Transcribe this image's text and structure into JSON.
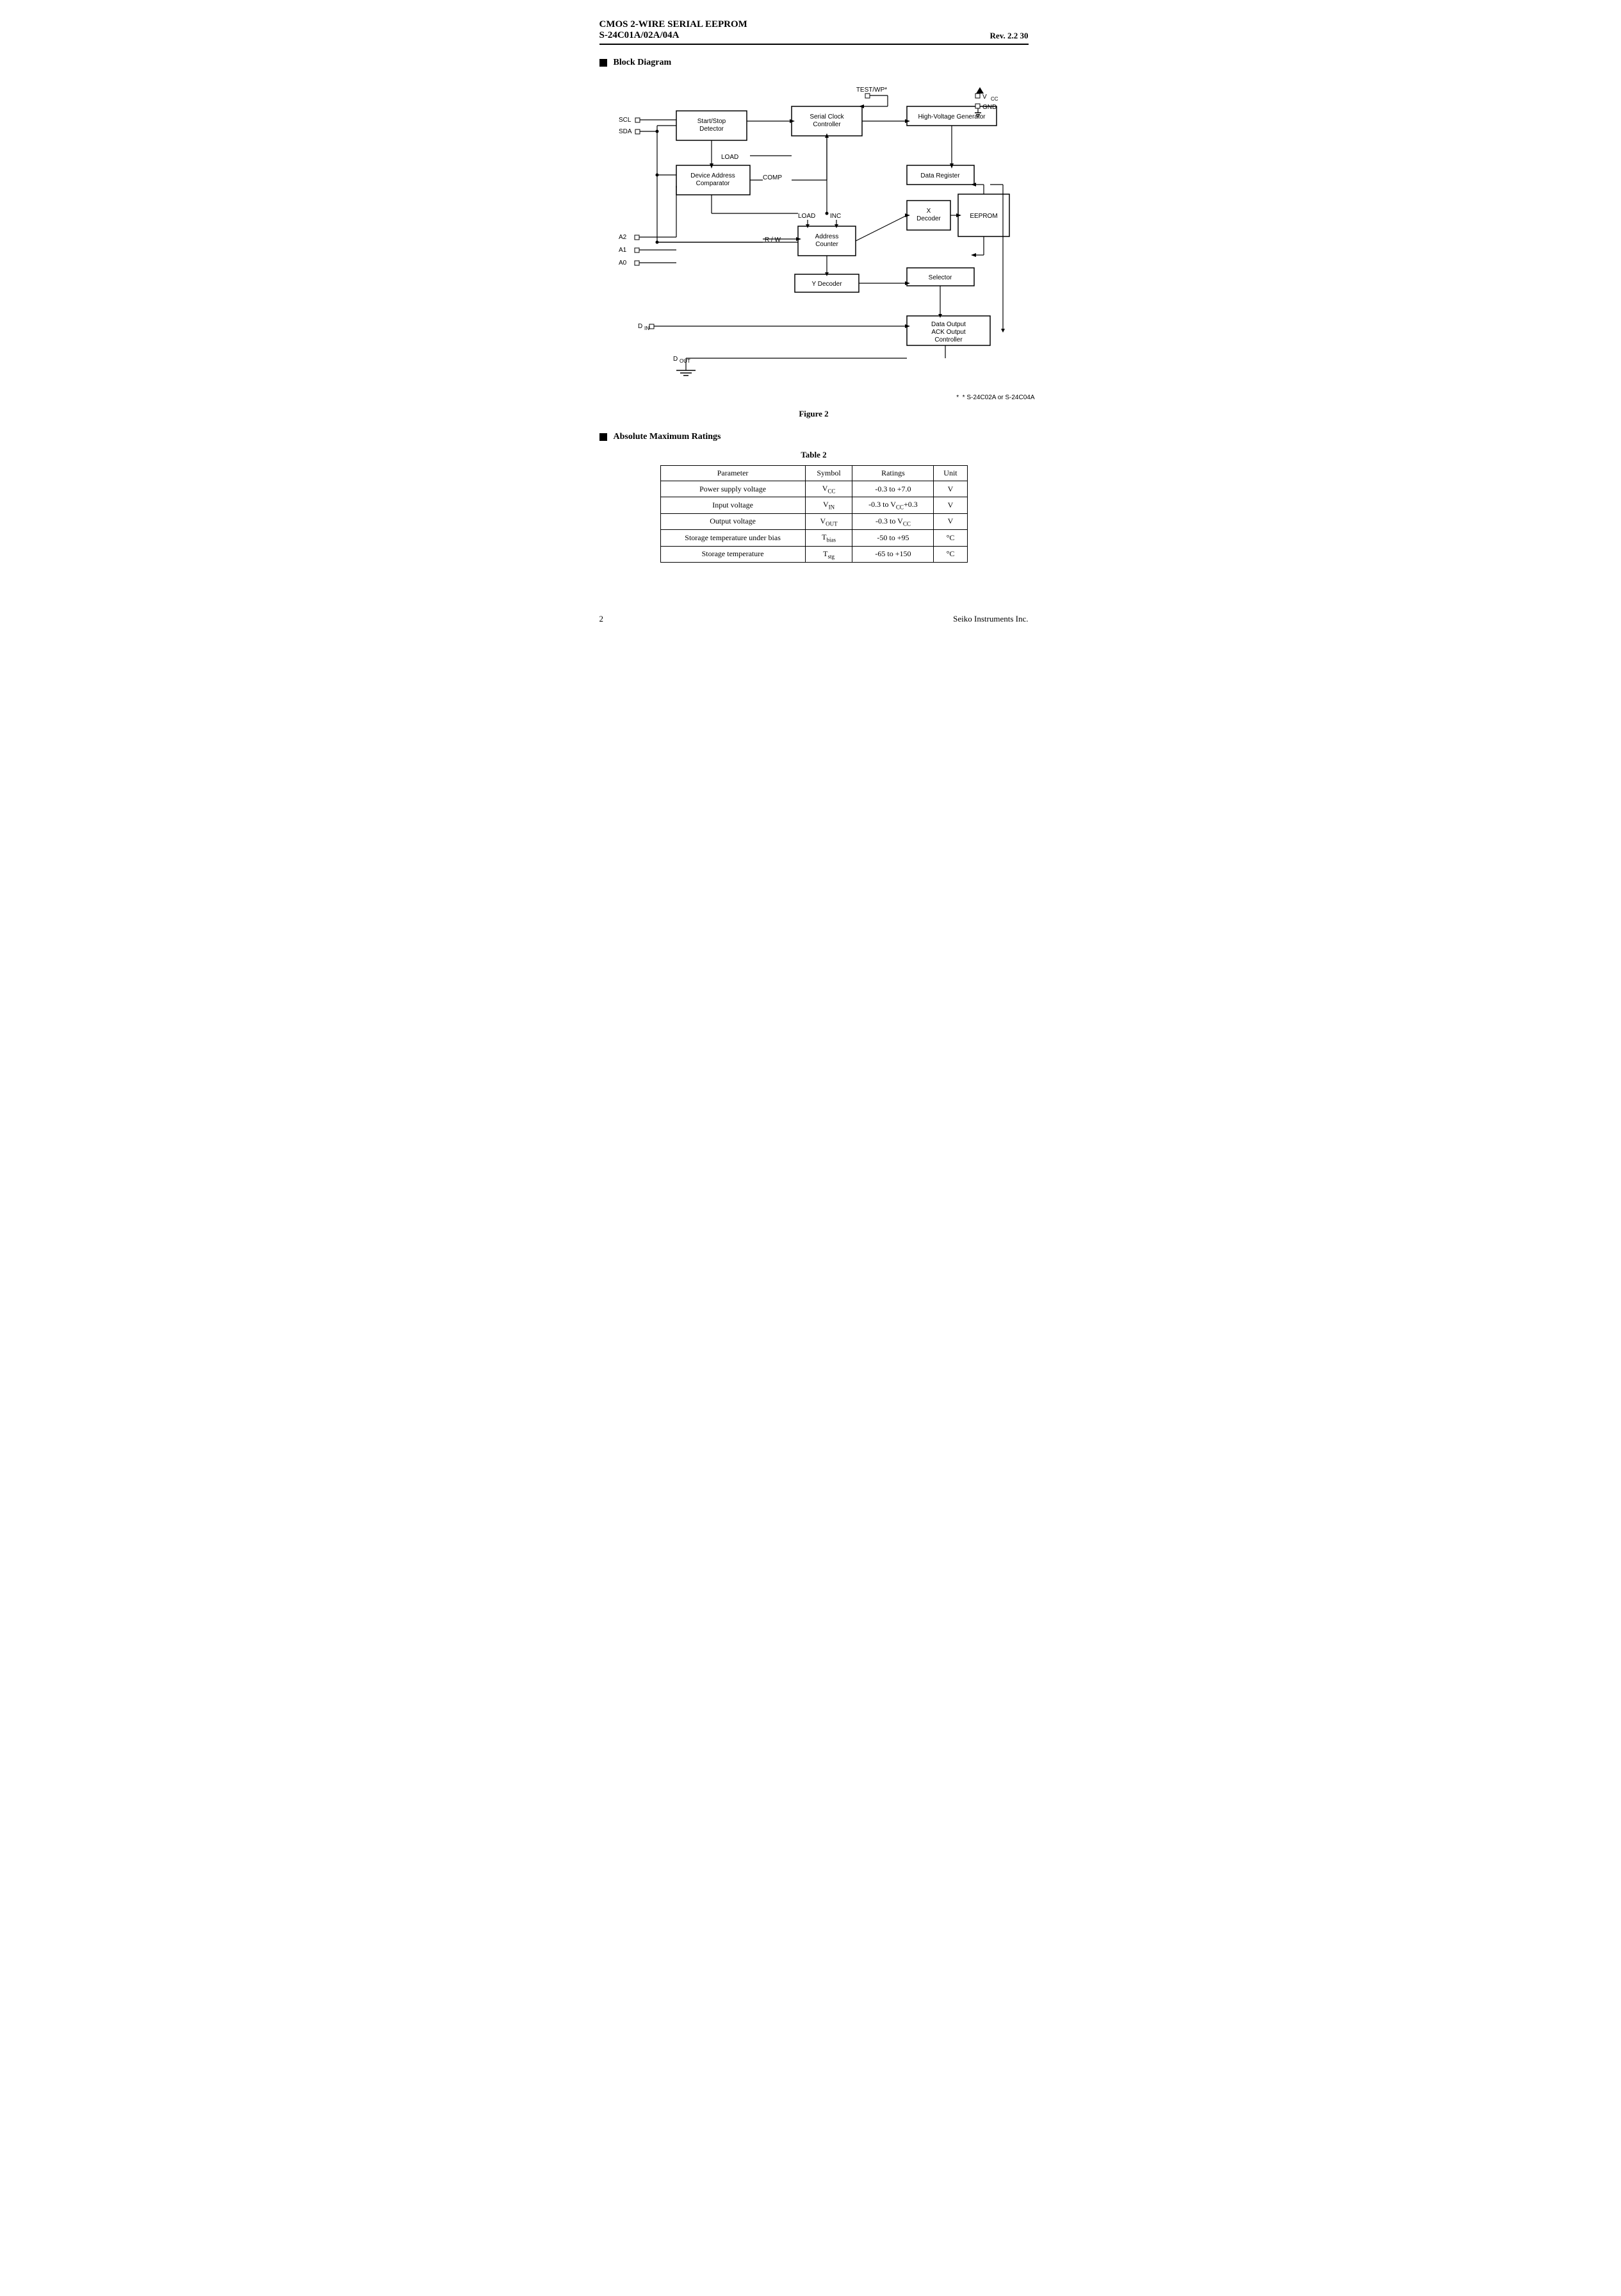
{
  "header": {
    "title": "CMOS 2-WIRE SERIAL  EEPROM",
    "subtitle": "S-24C01A/02A/04A",
    "rev": "Rev. 2.2",
    "page": "30"
  },
  "section1": {
    "label": "Block Diagram"
  },
  "diagram": {
    "blocks": {
      "startStop": "Start/Stop\nDetector",
      "serialClock": "Serial Clock\nController",
      "highVoltage": "High-Voltage Generator",
      "deviceAddr": "Device Address\nComparator",
      "dataRegister": "Data Register",
      "xDecoder": "X\nDecoder",
      "eeprom": "EEPROM",
      "addressCounter": "Address\nCounter",
      "yDecoder": "Y Decoder",
      "selector": "Selector",
      "dataOutput": "Data Output\nACK Output\nController"
    },
    "labels": {
      "scl": "SCL",
      "sda": "SDA",
      "a2": "A2",
      "a1": "A1",
      "a0": "A0",
      "din": "D",
      "din_sub": "IN",
      "dout": "D",
      "dout_sub": "OUT",
      "testWP": "TEST/WP*",
      "vcc": "V",
      "vcc_sub": "CC",
      "gnd": "GND",
      "load1": "LOAD",
      "comp": "COMP",
      "load2": "LOAD",
      "inc": "INC",
      "rw": "R / W"
    },
    "note": "* S-24C02A or S-24C04A"
  },
  "figure": {
    "label": "Figure 2"
  },
  "section2": {
    "label": "Absolute Maximum Ratings"
  },
  "table": {
    "title": "Table  2",
    "headers": [
      "Parameter",
      "Symbol",
      "Ratings",
      "Unit"
    ],
    "rows": [
      [
        "Power supply voltage",
        "V_CC",
        "-0.3 to +7.0",
        "V"
      ],
      [
        "Input voltage",
        "V_IN",
        "-0.3 to V_CC+0.3",
        "V"
      ],
      [
        "Output voltage",
        "V_OUT",
        "-0.3 to V_CC",
        "V"
      ],
      [
        "Storage temperature under bias",
        "T_bias",
        "-50 to +95",
        "°C"
      ],
      [
        "Storage temperature",
        "T_stg",
        "-65 to +150",
        "°C"
      ]
    ]
  },
  "footer": {
    "page": "2",
    "company": "Seiko Instruments Inc."
  }
}
